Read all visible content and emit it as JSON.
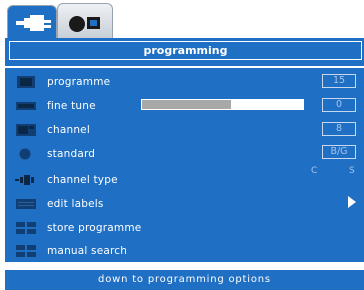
{
  "tabs": [
    {
      "icon": "tv-plug-icon",
      "active": true
    },
    {
      "icon": "globe-screen-icon",
      "active": false
    }
  ],
  "header": {
    "title": "programming"
  },
  "menu": {
    "items": [
      {
        "label": "programme",
        "icon": "tv-icon",
        "value": "15"
      },
      {
        "label": "fine tune",
        "icon": "tune-bar-icon",
        "value": "0",
        "slider_level": 0.55
      },
      {
        "label": "channel",
        "icon": "channel-screen-icon",
        "value": "8"
      },
      {
        "label": "standard",
        "icon": "globe-icon",
        "value": "B/G"
      },
      {
        "label": "channel type",
        "icon": "plug-icon",
        "extra_left": "C",
        "extra_right": "S"
      },
      {
        "label": "edit labels",
        "icon": "keyboard-icon"
      },
      {
        "label": "store programme",
        "icon": "store-grid-icon"
      },
      {
        "label": "manual search",
        "icon": "search-grid-icon"
      }
    ]
  },
  "footer": {
    "hint": "down to programming options"
  },
  "colors": {
    "panel": "#1f6fc4",
    "background": "#ffffff",
    "value_text": "#a9c4e6"
  }
}
